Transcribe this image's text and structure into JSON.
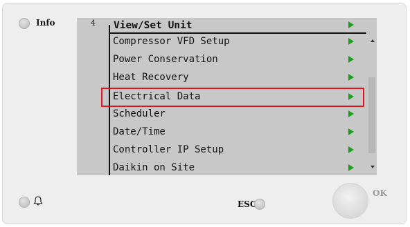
{
  "header": {
    "info_label": "Info",
    "page_number": "4",
    "title": "View/Set Unit"
  },
  "menu": {
    "items": [
      {
        "label": "Compressor VFD Setup",
        "highlighted": false
      },
      {
        "label": "Power Conservation",
        "highlighted": false
      },
      {
        "label": "Heat Recovery",
        "highlighted": false
      },
      {
        "label": "Electrical Data",
        "highlighted": true
      },
      {
        "label": "Scheduler",
        "highlighted": false
      },
      {
        "label": "Date/Time",
        "highlighted": false
      },
      {
        "label": "Controller IP Setup",
        "highlighted": false
      },
      {
        "label": "Daikin on Site",
        "highlighted": false
      }
    ],
    "arrow_icon": "green-triangle-right",
    "arrow_color": "#1aa01a",
    "highlight_color": "#e0141e"
  },
  "controls": {
    "esc_label": "ESC",
    "ok_label": "OK",
    "bell_icon": "bell-icon"
  }
}
